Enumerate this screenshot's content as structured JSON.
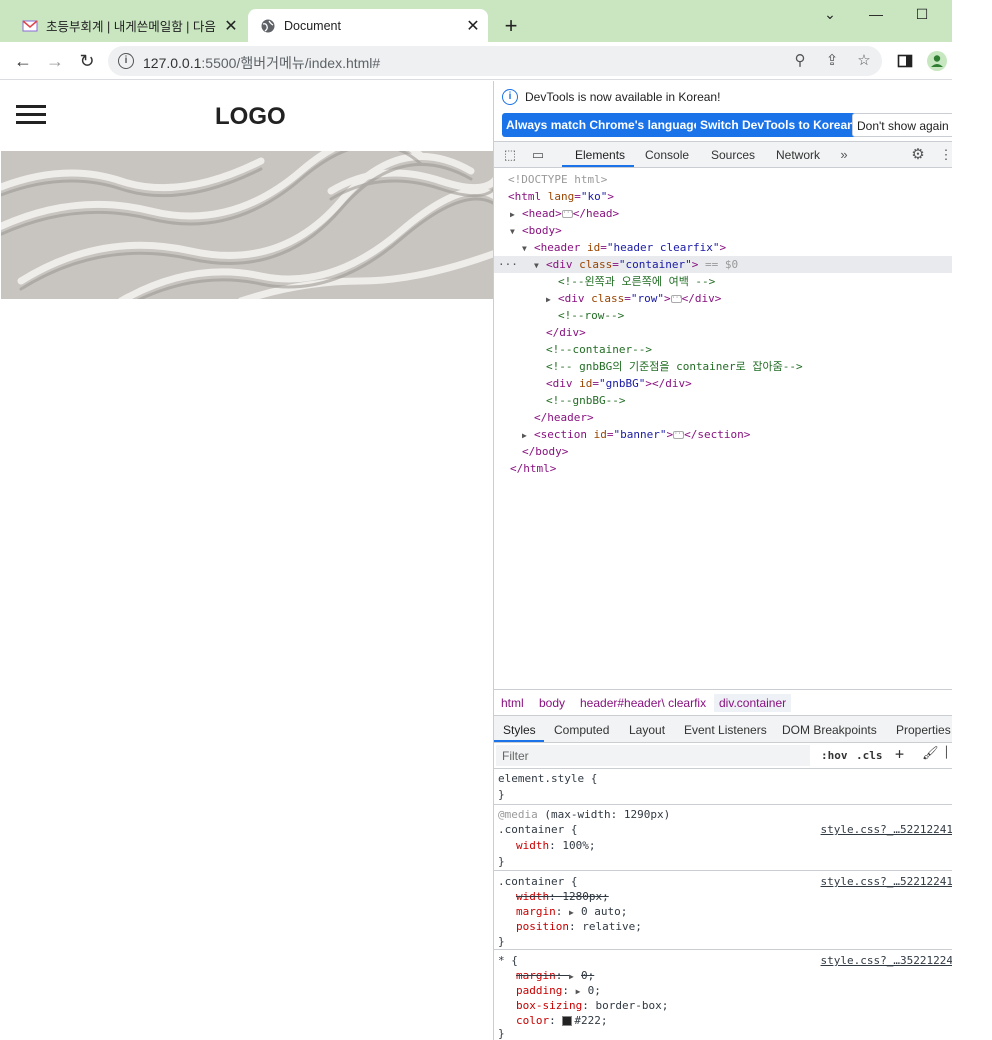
{
  "browser": {
    "tabs": [
      {
        "title": "초등부회계 | 내게쓴메일함 | 다음",
        "active": false
      },
      {
        "title": "Document",
        "active": true
      }
    ],
    "url_host": "127.0.0.1",
    "url_path": ":5500/햄버거메뉴/index.html#"
  },
  "page": {
    "logo": "LOGO"
  },
  "devtools": {
    "notice": {
      "text": "DevTools is now available in Korean!",
      "btn_match": "Always match Chrome's language",
      "btn_switch": "Switch DevTools to Korean",
      "btn_dismiss": "Don't show again"
    },
    "tabs": [
      "Elements",
      "Console",
      "Sources",
      "Network"
    ],
    "dom": {
      "doctype": "<!DOCTYPE html>",
      "html_open": "<html",
      "html_attr": "lang",
      "html_val": "\"ko\"",
      "head": "<head>",
      "head_close": "</head>",
      "body": "<body>",
      "header_tag": "<header",
      "header_attr": "id",
      "header_val": "\"header clearfix\"",
      "div_tag": "<div",
      "div_attr": "class",
      "div_val": "\"container\"",
      "eq": "== $0",
      "c1": "<!--왼쪽과 오른쪽에 여백 -->",
      "row_tag": "<div",
      "row_attr": "class",
      "row_val": "\"row\"",
      "row_close": "</div>",
      "c2": "<!--row-->",
      "div_close": "</div>",
      "c3": "<!--container-->",
      "c4": "<!--  gnbBG의 기준점을 container로 잡아줌-->",
      "gnb_tag": "<div",
      "gnb_attr": "id",
      "gnb_val": "\"gnbBG\"",
      "gnb_close": "></div>",
      "c5": "<!--gnbBG-->",
      "header_close": "</header>",
      "section_tag": "<section",
      "section_attr": "id",
      "section_val": "\"banner\"",
      "section_close": "</section>",
      "body_close": "</body>",
      "html_close": "</html>"
    },
    "breadcrumb": [
      "html",
      "body",
      "header#header\\ clearfix",
      "div.container"
    ],
    "styles_tabs": [
      "Styles",
      "Computed",
      "Layout",
      "Event Listeners",
      "DOM Breakpoints",
      "Properties"
    ],
    "filter_placeholder": "Filter",
    "hov": ":hov",
    "cls": ".cls",
    "rules": {
      "r1_sel": "element.style {",
      "close": "}",
      "r2_media": "@media",
      "r2_query": "(max-width: 1290px)",
      "r2_sel": ".container {",
      "r2_src": "style.css?_…52212241",
      "r2_p1": "width",
      "r2_v1": "100%;",
      "r3_sel": ".container {",
      "r3_src": "style.css?_…52212241",
      "r3_p1": "width",
      "r3_v1": "1280px;",
      "r3_p2": "margin",
      "r3_v2": "0 auto;",
      "r3_p3": "position",
      "r3_v3": "relative;",
      "r4_sel": "* {",
      "r4_src": "style.css?_…35221224",
      "r4_p1": "margin",
      "r4_v1": "0;",
      "r4_p2": "padding",
      "r4_v2": "0;",
      "r4_p3": "box-sizing",
      "r4_v3": "border-box;",
      "r4_p4": "color",
      "r4_v4": "#222;"
    }
  }
}
